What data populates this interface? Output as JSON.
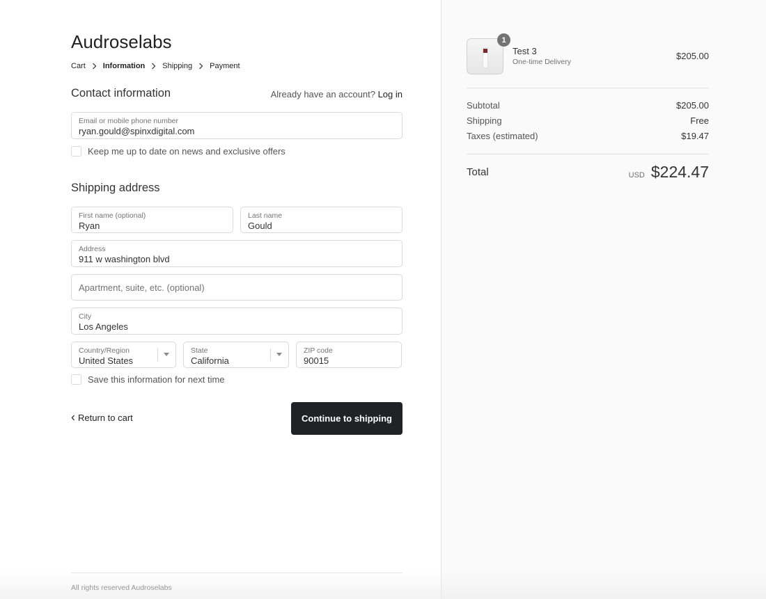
{
  "store": {
    "name": "Audroselabs"
  },
  "breadcrumb": [
    {
      "label": "Cart"
    },
    {
      "label": "Information"
    },
    {
      "label": "Shipping"
    },
    {
      "label": "Payment"
    }
  ],
  "contact": {
    "title": "Contact information",
    "account_prompt": "Already have an account?",
    "login_label": "Log in",
    "email_label": "Email or mobile phone number",
    "email_value": "ryan.gould@spinxdigital.com",
    "newsletter_label": "Keep me up to date on news and exclusive offers",
    "newsletter_checked": false
  },
  "shipping": {
    "title": "Shipping address",
    "first_name_label": "First name (optional)",
    "first_name_value": "Ryan",
    "last_name_label": "Last name",
    "last_name_value": "Gould",
    "address_label": "Address",
    "address_value": "911 w washington blvd",
    "apartment_placeholder": "Apartment, suite, etc. (optional)",
    "city_label": "City",
    "city_value": "Los Angeles",
    "country_label": "Country/Region",
    "country_value": "United States",
    "state_label": "State",
    "state_value": "California",
    "zip_label": "ZIP code",
    "zip_value": "90015",
    "save_info_label": "Save this information for next time",
    "save_info_checked": false
  },
  "actions": {
    "return_label": "Return to cart",
    "continue_label": "Continue to shipping"
  },
  "footer": {
    "text": "All rights reserved Audroselabs"
  },
  "order_summary": {
    "item": {
      "name": "Test 3",
      "variant": "One-time Delivery",
      "price": "$205.00",
      "quantity": "1"
    },
    "subtotal_label": "Subtotal",
    "subtotal_value": "$205.00",
    "shipping_label": "Shipping",
    "shipping_value": "Free",
    "taxes_label": "Taxes (estimated)",
    "taxes_value": "$19.47",
    "total_label": "Total",
    "currency": "USD",
    "total_value": "$224.47"
  }
}
